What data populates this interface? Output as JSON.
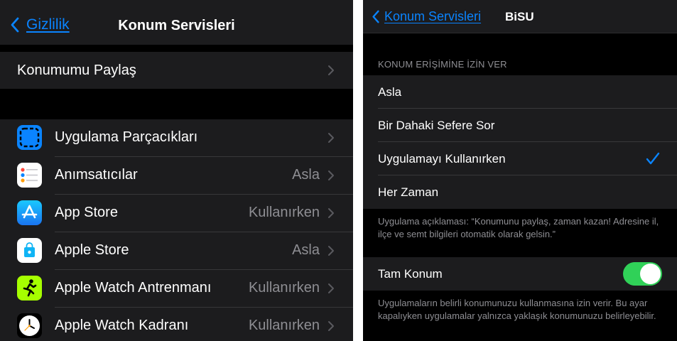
{
  "left": {
    "nav": {
      "back_label": "Gizlilik",
      "title": "Konum Servisleri"
    },
    "share_row": {
      "label": "Konumumu Paylaş"
    },
    "apps": [
      {
        "name": "Uygulama Parçacıkları",
        "value": "",
        "icon": "app-clips-icon"
      },
      {
        "name": "Anımsatıcılar",
        "value": "Asla",
        "icon": "reminders-icon"
      },
      {
        "name": "App Store",
        "value": "Kullanırken",
        "icon": "app-store-icon"
      },
      {
        "name": "Apple Store",
        "value": "Asla",
        "icon": "apple-store-icon"
      },
      {
        "name": "Apple Watch Antrenmanı",
        "value": "Kullanırken",
        "icon": "workout-icon"
      },
      {
        "name": "Apple Watch Kadranı",
        "value": "Kullanırken",
        "icon": "watch-face-icon"
      }
    ]
  },
  "right": {
    "nav": {
      "back_label": "Konum Servisleri",
      "title": "BiSU"
    },
    "section_header": "KONUM ERİŞİMİNE İZİN VER",
    "options": [
      {
        "label": "Asla",
        "selected": false
      },
      {
        "label": "Bir Dahaki Sefere Sor",
        "selected": false
      },
      {
        "label": "Uygulamayı Kullanırken",
        "selected": true
      },
      {
        "label": "Her Zaman",
        "selected": false
      }
    ],
    "app_description": "Uygulama açıklaması: “Konumunu paylaş, zaman kazan! Adresine il, ilçe ve semt bilgileri otomatik olarak gelsin.”",
    "precise_location": {
      "label": "Tam Konum",
      "enabled": true
    },
    "precise_note": "Uygulamaların belirli konumunuzu kullanmasına izin verir. Bu ayar kapalıyken uygulamalar yalnızca yaklaşık konumunuzu belirleyebilir."
  },
  "colors": {
    "accent": "#0a84ff",
    "toggle_on": "#30d158",
    "cell_bg": "#1c1c1e",
    "secondary_text": "#8e8e93"
  }
}
